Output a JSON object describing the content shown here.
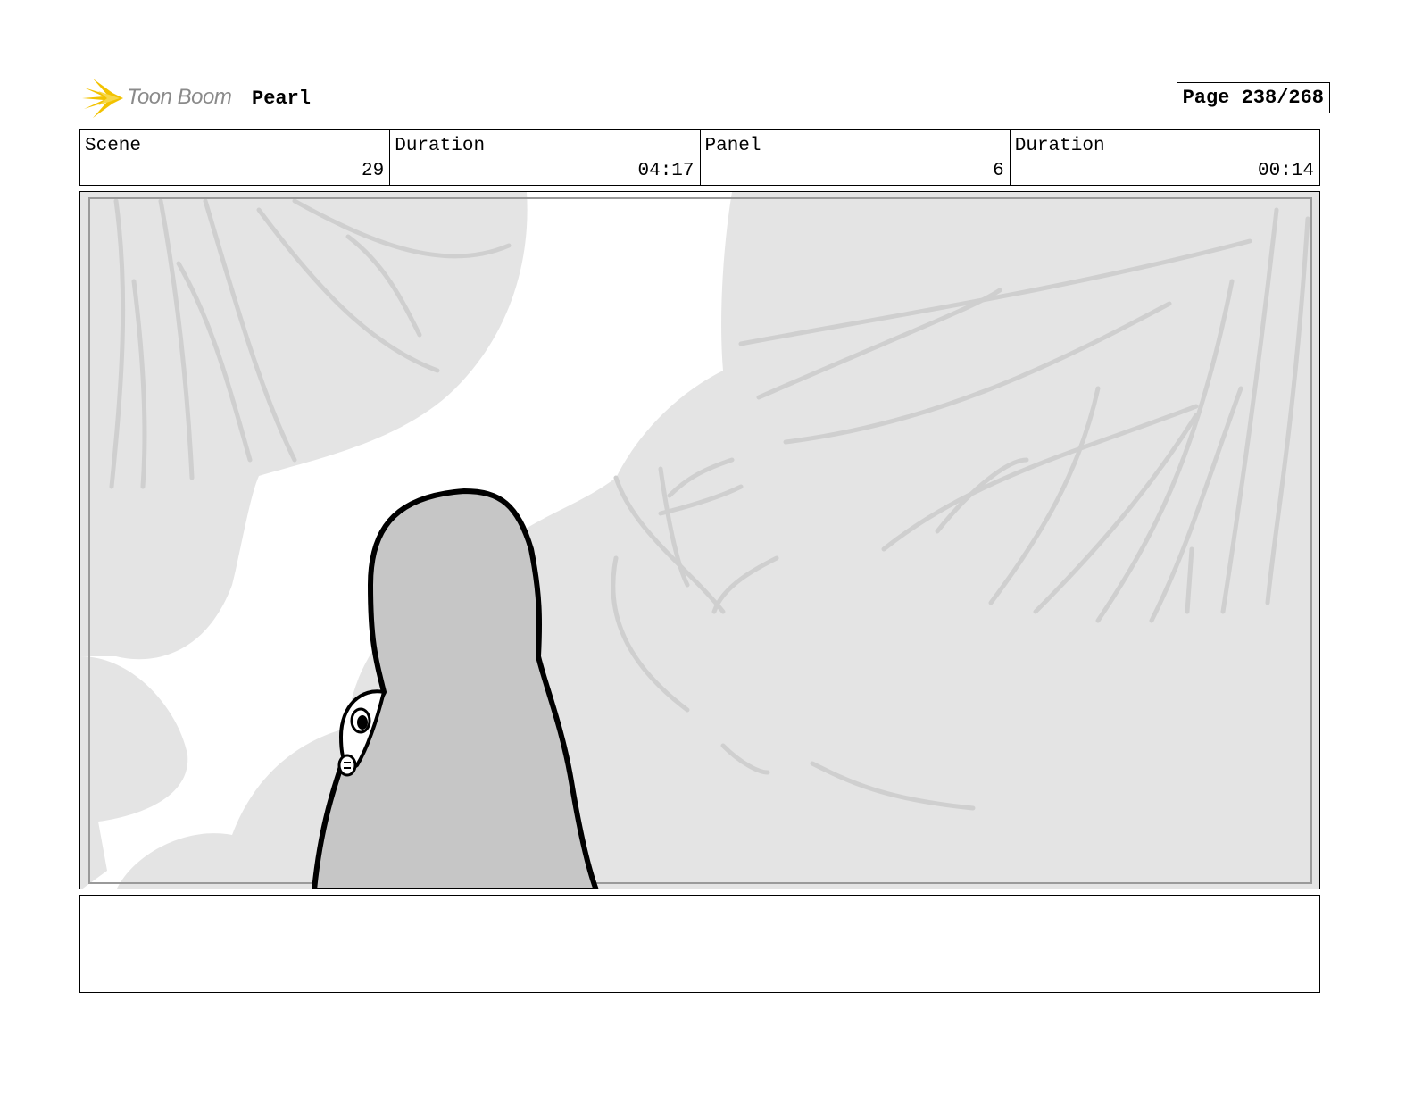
{
  "header": {
    "logo_text": "Toon Boom",
    "project_title": "Pearl",
    "page_label": "Page 238/268"
  },
  "info": {
    "scene_label": "Scene",
    "scene_value": "29",
    "scene_duration_label": "Duration",
    "scene_duration_value": "04:17",
    "panel_label": "Panel",
    "panel_value": "6",
    "panel_duration_label": "Duration",
    "panel_duration_value": "00:14"
  },
  "notes": {
    "text": ""
  }
}
